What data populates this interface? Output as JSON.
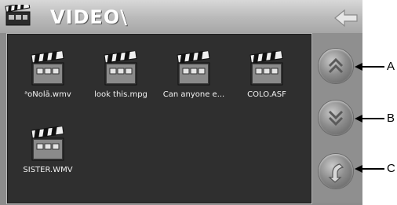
{
  "title": {
    "text": "VIDEO\\"
  },
  "files": [
    {
      "name": "ᵃoNolā.wmv"
    },
    {
      "name": "look this.mpg"
    },
    {
      "name": "Can anyone e..."
    },
    {
      "name": "COLO.ASF"
    },
    {
      "name": "SISTER.WMV"
    }
  ],
  "callouts": {
    "a": "A",
    "b": "B",
    "c": "C"
  },
  "colors": {
    "panel": "#2f2f2f",
    "frame": "#8c8c8c",
    "label_text": "#f2f2f2"
  }
}
